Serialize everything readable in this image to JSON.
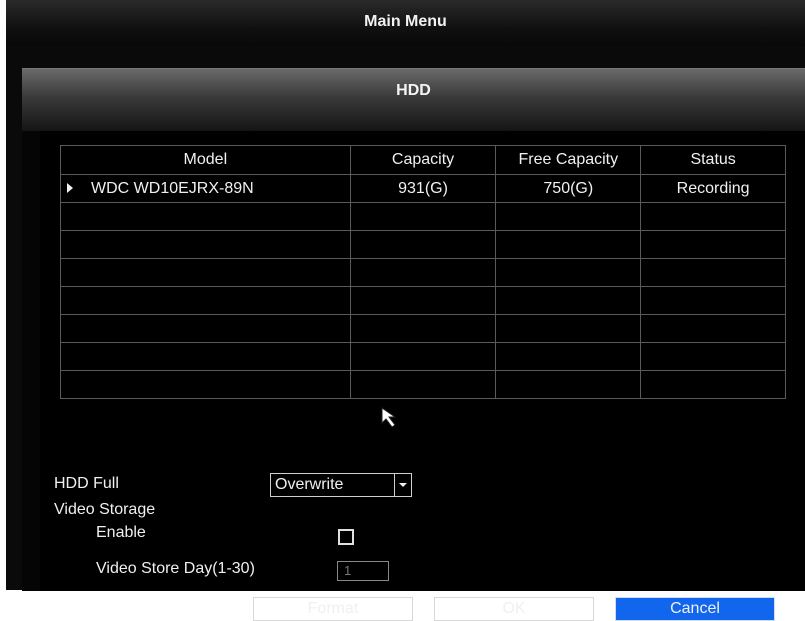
{
  "main_menu": {
    "title": "Main Menu"
  },
  "hdd": {
    "title": "HDD",
    "table": {
      "headers": [
        "Model",
        "Capacity",
        "Free Capacity",
        "Status"
      ],
      "rows": [
        {
          "model": "WDC WD10EJRX-89N",
          "capacity": "931(G)",
          "free_capacity": "750(G)",
          "status": "Recording",
          "selected": true
        }
      ]
    },
    "hdd_full": {
      "label": "HDD Full",
      "value": "Overwrite"
    },
    "video_storage": {
      "label": "Video Storage",
      "enable_label": "Enable",
      "enabled": false,
      "store_day_label": "Video Store Day(1-30)",
      "store_day_value": "1"
    },
    "buttons": {
      "format": "Format",
      "ok": "OK",
      "cancel": "Cancel"
    }
  },
  "colors": {
    "accent": "#1266ee",
    "background": "#000000",
    "text": "#f0f0f0"
  }
}
